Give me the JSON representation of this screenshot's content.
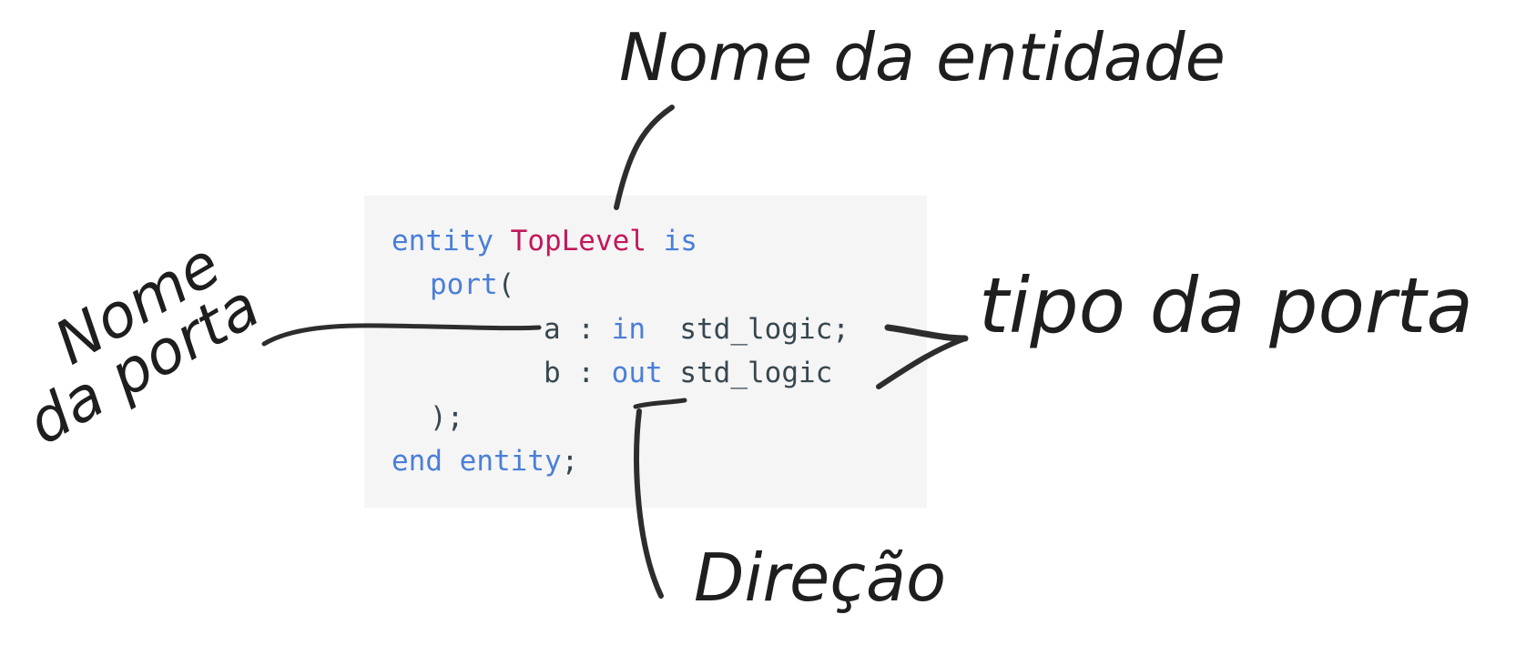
{
  "code": {
    "line1": {
      "kw1": "entity",
      "name": "TopLevel",
      "kw2": "is"
    },
    "line2": {
      "kw": "port",
      "punct": "("
    },
    "line3": {
      "port": "a",
      "colon": " : ",
      "dir": "in",
      "type": "std_logic;"
    },
    "line4": {
      "port": "b",
      "colon": " : ",
      "dir": "out",
      "type": "std_logic"
    },
    "line5": {
      "punct": ");"
    },
    "line6": {
      "kw1": "end",
      "kw2": "entity",
      "punct": ";"
    }
  },
  "annotations": {
    "entity_name": "Nome da entidade",
    "port_name_line1": "Nome",
    "port_name_line2": "da porta",
    "port_type": "tipo da porta",
    "direction": "Direção"
  },
  "colors": {
    "keyword": "#4a7fd8",
    "entity_name": "#c2185b",
    "plain": "#37474f",
    "code_background": "#f5f5f5",
    "ink": "#2d2d2d"
  }
}
